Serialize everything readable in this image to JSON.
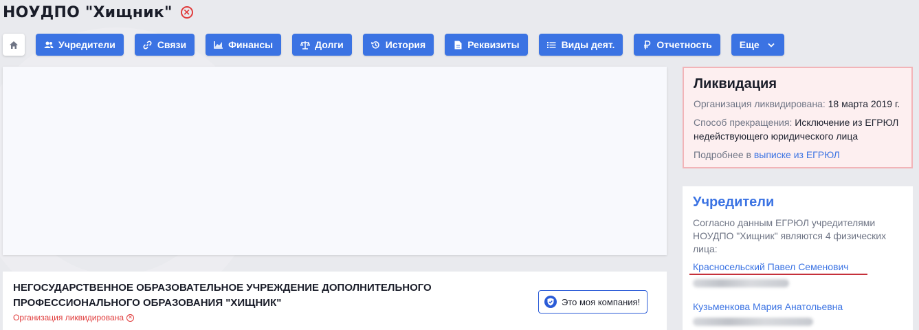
{
  "header": {
    "title": "НОУДПО \"Хищник\"",
    "status_icon": "close-circle-icon"
  },
  "toolbar": {
    "home_icon": "home-icon",
    "buttons": [
      {
        "label": "Учредители",
        "icon": "users-icon"
      },
      {
        "label": "Связи",
        "icon": "link-icon"
      },
      {
        "label": "Финансы",
        "icon": "chart-icon"
      },
      {
        "label": "Долги",
        "icon": "scales-icon"
      },
      {
        "label": "История",
        "icon": "history-icon"
      },
      {
        "label": "Реквизиты",
        "icon": "document-icon"
      },
      {
        "label": "Виды деят.",
        "icon": "list-icon"
      },
      {
        "label": "Отчетность",
        "icon": "ruble-icon"
      },
      {
        "label": "Еще",
        "icon": "chevron-down-icon"
      }
    ]
  },
  "company": {
    "full_name": "НЕГОСУДАРСТВЕННОЕ ОБРАЗОВАТЕЛЬНОЕ УЧРЕЖДЕНИЕ ДОПОЛНИТЕЛЬНОГО ПРОФЕССИОНАЛЬНОГО ОБРАЗОВАНИЯ \"ХИЩНИК\"",
    "status": "Организация ликвидирована",
    "my_company_label": "Это моя компания!"
  },
  "liquidation": {
    "title": "Ликвидация",
    "liquidated_label": "Организация ликвидирована:",
    "liquidated_date": "18 марта 2019 г.",
    "method_label": "Способ прекращения:",
    "method_value": "Исключение из ЕГРЮЛ недействующего юридического лица",
    "more_prefix": "Подробнее в",
    "more_link": "выписке из ЕГРЮЛ"
  },
  "founders": {
    "title": "Учредители",
    "description": "Согласно данным ЕГРЮЛ учредителями НОУДПО \"Хищник\" являются 4 физических лица:",
    "people": [
      {
        "name": "Красносельский Павел Семенович"
      },
      {
        "name": "Кузьменкова Мария Анатольевна"
      }
    ]
  },
  "colors": {
    "accent": "#3b73e3",
    "danger": "#e03b3b",
    "liquidation_bg": "#fdeff0",
    "liquidation_border": "#f2b4b8"
  }
}
